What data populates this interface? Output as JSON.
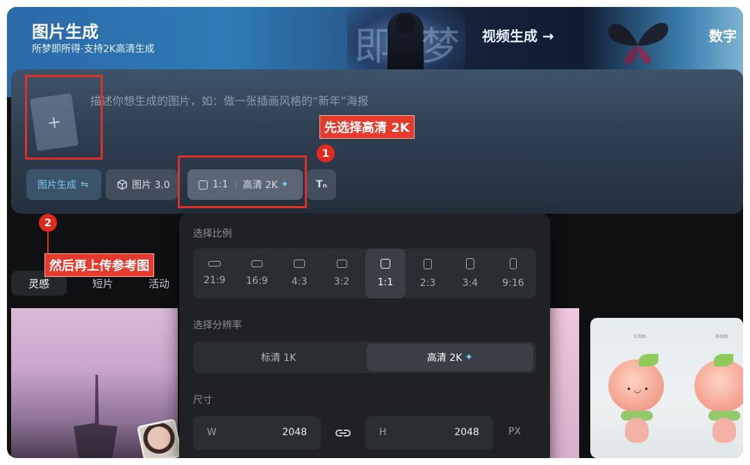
{
  "header": {
    "title": "图片生成",
    "subtitle": "所梦即所得·支持2K高清生成",
    "video_tab": "视频生成 →",
    "digital_tab": "数字",
    "art_chars": [
      "即",
      "梦"
    ]
  },
  "prompt": {
    "placeholder": "描述你想生成的图片，如：做一张插画风格的“新年”海报",
    "upload_symbol": "+"
  },
  "toolbar": {
    "mode": "图片生成",
    "mode_icon": "⇋",
    "model": "图片 3.0",
    "ratio": "1:1",
    "quality": "高清 2K",
    "text_icon": "Tₙ"
  },
  "annotations": {
    "step1_label": "先选择高清 2K",
    "step1_num": "1",
    "step2_label": "然后再上传参考图",
    "step2_num": "2",
    "color": "#e23024"
  },
  "categories": [
    "灵感",
    "短片",
    "活动"
  ],
  "dropdown": {
    "ratio_label": "选择比例",
    "ratios": [
      {
        "label": "21:9",
        "active": false
      },
      {
        "label": "16:9",
        "active": false
      },
      {
        "label": "4:3",
        "active": false
      },
      {
        "label": "3:2",
        "active": false
      },
      {
        "label": "1:1",
        "active": true
      },
      {
        "label": "2:3",
        "active": false
      },
      {
        "label": "3:4",
        "active": false
      },
      {
        "label": "9:16",
        "active": false
      }
    ],
    "resolution_label": "选择分辨率",
    "resolutions": [
      {
        "label": "标清 1K",
        "active": false
      },
      {
        "label": "高清 2K",
        "active": true
      }
    ],
    "size_label": "尺寸",
    "width_key": "W",
    "width_value": "2048",
    "height_key": "H",
    "height_value": "2048",
    "unit": "PX"
  },
  "gallery": {
    "peach_tags": [
      "正视图",
      "侧视图"
    ]
  }
}
